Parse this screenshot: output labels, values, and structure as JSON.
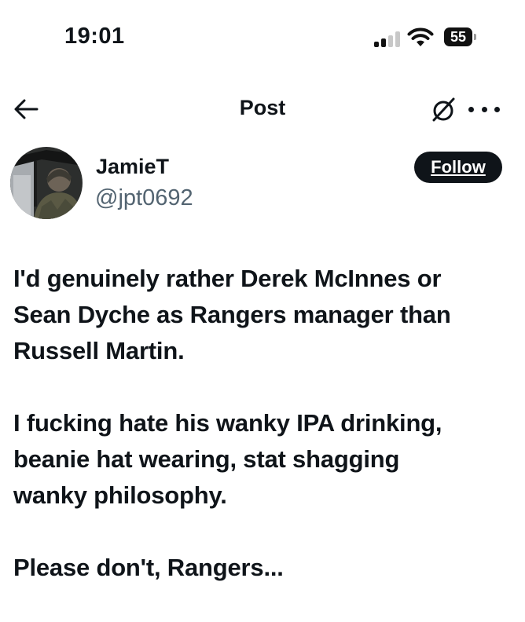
{
  "status_bar": {
    "time": "19:01",
    "battery_level": "55",
    "icons": [
      "cellular-signal-icon",
      "wifi-icon",
      "battery-icon"
    ]
  },
  "nav": {
    "title": "Post",
    "icons": [
      "back-arrow-icon",
      "grok-icon",
      "more-options-icon"
    ]
  },
  "author": {
    "name": "JamieT",
    "handle": "@jpt0692"
  },
  "actions": {
    "follow_label": "Follow"
  },
  "post": {
    "paragraphs": [
      [
        "I'd genuinely rather Derek McInnes or",
        "Sean Dyche as Rangers manager than",
        "Russell Martin."
      ],
      [
        "I fucking hate his wanky IPA drinking,",
        "beanie hat wearing, stat shagging",
        "wanky philosophy."
      ],
      [
        "Please don't, Rangers..."
      ]
    ]
  },
  "colors": {
    "text": "#0f1419",
    "secondary_text": "#536471",
    "follow_button_bg": "#0f1419",
    "follow_button_text": "#ffffff",
    "background": "#ffffff"
  }
}
